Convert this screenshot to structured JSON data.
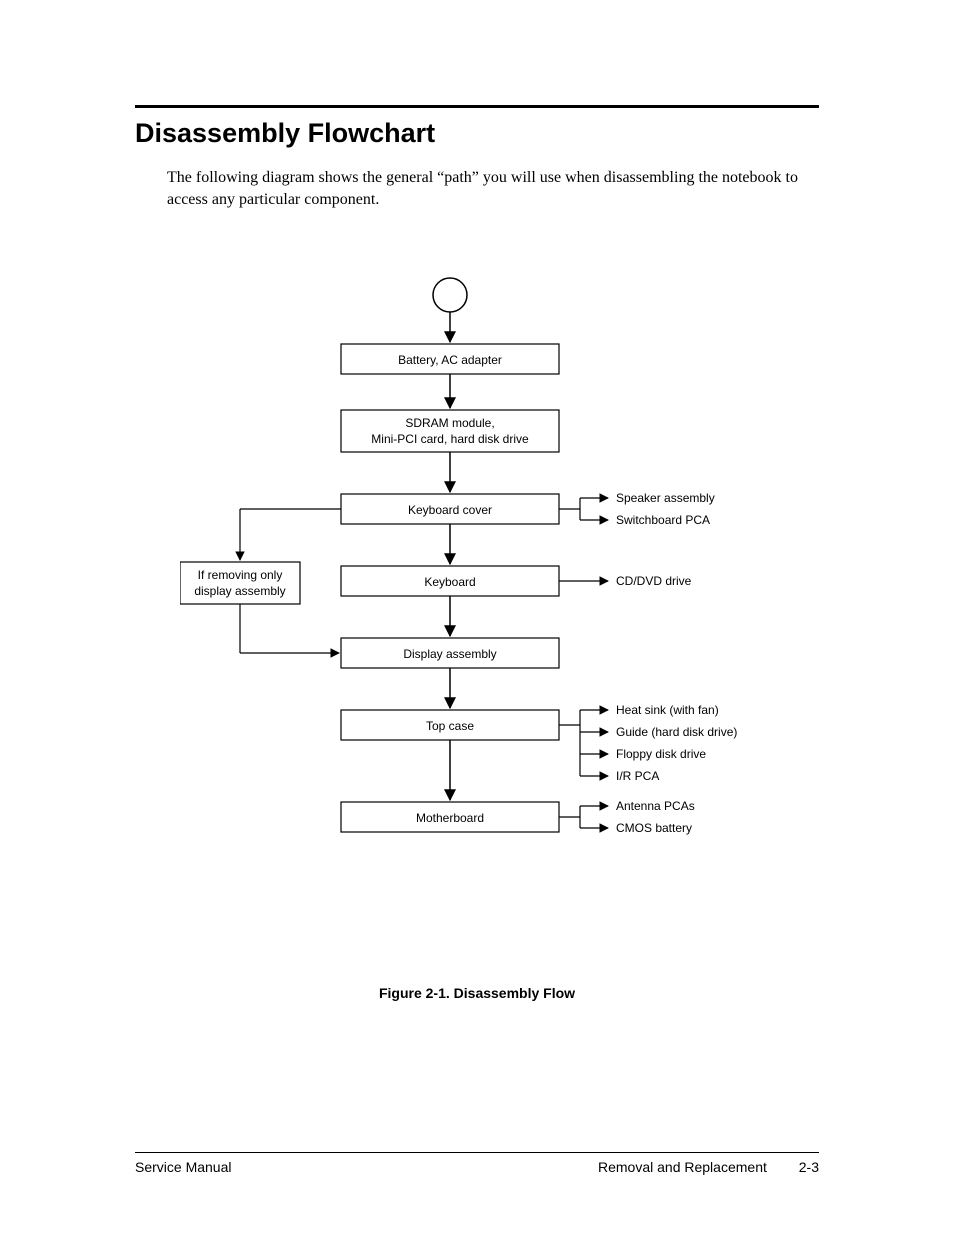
{
  "header": {
    "title": "Disassembly Flowchart"
  },
  "intro": "The following diagram shows the general “path” you will use when disassembling the notebook to access any particular component.",
  "figure_caption": "Figure 2-1. Disassembly Flow",
  "footer": {
    "left": "Service Manual",
    "center": "Removal and Replacement",
    "page": "2-3"
  },
  "flow": {
    "boxes": {
      "b1": "Battery, AC adapter",
      "b2_l1": "SDRAM module,",
      "b2_l2": "Mini-PCI card, hard disk drive",
      "b3": "Keyboard cover",
      "b4": "Keyboard",
      "b5": "Display assembly",
      "b6": "Top case",
      "b7": "Motherboard",
      "side_l1": "If removing only",
      "side_l2": "display assembly"
    },
    "outs": {
      "kc1": "Speaker assembly",
      "kc2": "Switchboard PCA",
      "kb1": "CD/DVD drive",
      "tc1": "Heat sink (with fan)",
      "tc2": "Guide (hard disk drive)",
      "tc3": "Floppy disk drive",
      "tc4": "I/R PCA",
      "mb1": "Antenna PCAs",
      "mb2": "CMOS battery"
    }
  }
}
